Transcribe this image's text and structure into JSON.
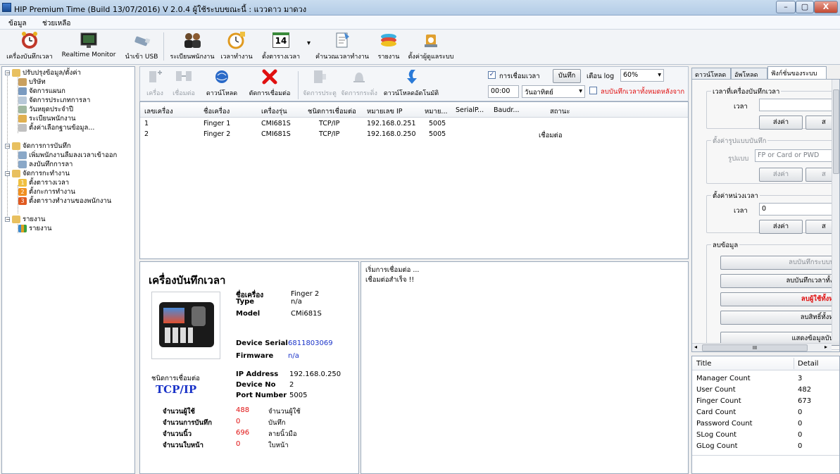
{
  "window": {
    "title": "HIP Premium Time (Build 13/07/2016) V 2.0.4   ผู้ใช้ระบบขณะนี้  : แววดาว  มาดวง",
    "minimize": "–",
    "maximize": "▢",
    "close": "X"
  },
  "menu": [
    "ข้อมูล",
    "ช่วยเหลือ"
  ],
  "toolbar": [
    {
      "label": "เครื่องบันทึกเวลา",
      "icon": "clock-icon"
    },
    {
      "label": "Realtime Monitor",
      "icon": "monitor-icon"
    },
    {
      "label": "นำเข้า USB",
      "icon": "usb-icon"
    },
    {
      "label": "ระเบียนพนักงาน",
      "icon": "employees-icon"
    },
    {
      "label": "เวลาทำงาน",
      "icon": "work-time-icon"
    },
    {
      "label": "ตั้งตารางเวลา",
      "icon": "calendar-icon"
    },
    {
      "label": "คำนวณเวลาทำงาน",
      "icon": "calculate-icon"
    },
    {
      "label": "รายงาน",
      "icon": "report-icon"
    },
    {
      "label": "ตั้งค่าผู้ดูแลระบบ",
      "icon": "admin-settings-icon"
    }
  ],
  "calendar_day": "14",
  "tree": [
    {
      "label": "ปรับปรุงข้อมูล/ตั้งค่า",
      "level": 0
    },
    {
      "label": "บริษัท",
      "level": 1
    },
    {
      "label": "จัดการแผนก",
      "level": 1
    },
    {
      "label": "จัดการประเภทการลา",
      "level": 1
    },
    {
      "label": "วันหยุดประจำปี",
      "level": 1
    },
    {
      "label": "ระเบียนพนักงาน",
      "level": 1
    },
    {
      "label": "ตั้งค่าเลือกฐานข้อมูล...",
      "level": 1
    },
    {
      "label": "จัดการการบันทึก",
      "level": 0
    },
    {
      "label": "เพิ่มพนักงานลืมลงเวลาเข้าออก",
      "level": 1
    },
    {
      "label": "ลงบันทึกการลา",
      "level": 1
    },
    {
      "label": "จัดการกะทำงาน",
      "level": 0
    },
    {
      "label": "ตั้งตารางเวลา",
      "level": 1,
      "num": "1"
    },
    {
      "label": "ตั้งกะการทำงาน",
      "level": 1,
      "num": "2"
    },
    {
      "label": "ตั้งตารางทำงานของพนักงาน",
      "level": 1,
      "num": "3"
    },
    {
      "label": "รายงาน",
      "level": 0
    },
    {
      "label": "รายงาน",
      "level": 1
    }
  ],
  "device_toolbar": {
    "buttons": [
      "เครื่อง",
      "เชื่อมต่อ",
      "ดาวน์โหลด",
      "ตัดการเชื่อมต่อ",
      "จัดการประตู",
      "จัดการกระดิ่ง",
      "ดาวน์โหลดอัตโนมัติ"
    ],
    "sync_time_label": "การเชื่อมเวลา",
    "save_button": "บันทึก",
    "log_warn_label": "เตือน log",
    "log_percent": "60%",
    "time_value": "00:00",
    "day_value": "วันอาทิตย์",
    "delete_after_label": "ลบบันทึกเวลาทั้งหมดหลังจาก"
  },
  "device_table": {
    "columns": [
      "เลขเครื่อง",
      "ชื่อเครื่อง",
      "เครื่องรุ่น",
      "ชนิดการเชื่อมต่อ",
      "หมายเลข IP",
      "หมาย...",
      "SerialP...",
      "Baudr...",
      "สถานะ"
    ],
    "rows": [
      [
        "1",
        "Finger 1",
        "CMI681S",
        "TCP/IP",
        "192.168.0.251",
        "5005",
        "",
        "",
        ""
      ],
      [
        "2",
        "Finger 2",
        "CMI681S",
        "TCP/IP",
        "192.168.0.250",
        "5005",
        "",
        "",
        "เชื่อมต่อ"
      ]
    ]
  },
  "device_info": {
    "heading": "เครื่องบันทึกเวลา",
    "name_label": "ชื่อเครื่อง",
    "name_value": "Finger 2",
    "type_label": "Type",
    "type_value": "n/a",
    "model_label": "Model",
    "model_value": "CMi681S",
    "serial_label": "Device Serial",
    "serial_value": "6811803069",
    "firmware_label": "Firmware",
    "firmware_value": "n/a",
    "conn_type_label": "ชนิดการเชื่อมต่อ",
    "conn_type_value": "TCP/IP",
    "ip_label": "IP Address",
    "ip_value": "192.168.0.250",
    "devno_label": "Device No",
    "devno_value": "2",
    "port_label": "Port Number",
    "port_value": "5005",
    "counts": [
      {
        "label": "จำนวนผู้ใช้",
        "value": "488",
        "unit": "จำนวนผู้ใช้"
      },
      {
        "label": "จำนวนการบันทึก",
        "value": "0",
        "unit": "บันทึก"
      },
      {
        "label": "จำนวนนิ้ว",
        "value": "696",
        "unit": "ลายนิ้วมือ"
      },
      {
        "label": "จำนวนใบหน้า",
        "value": "0",
        "unit": "ใบหน้า"
      }
    ]
  },
  "log_lines": [
    "เริ่มการเชื่อมต่อ ...",
    "เชื่อมต่อสำเร็จ !!"
  ],
  "right_tabs": [
    "ดาวน์โหลด",
    "อัพโหลด",
    "ฟังก์ชั่นของระบบ"
  ],
  "right_panel": {
    "set_time_group": "เวลาที่เครื่องบันทึกเวลา",
    "time_label": "เวลา",
    "send_button": "ส่งค่า",
    "cut_button": "ส",
    "format_group": "ตั้งค่ารูปแบบบันทึก",
    "format_label": "รูปแบบ",
    "format_value": "FP or Card or PWD",
    "interval_group": "ตั้งค่าหน่วงเวลา",
    "interval_value": "0",
    "delete_group": "ลบข้อมูล",
    "delete_buttons": [
      "ลบบันทึกระบบทั้งห",
      "ลบบันทึกเวลาทั้งหม",
      "ลบผู้ใช้ทั้งหมด",
      "ลบสิทธิ์ทั้งหมด",
      "แสดงข้อมูลบันทึก"
    ],
    "scroll_grip": "III"
  },
  "stats": {
    "header_title": "Title",
    "header_detail": "Detail",
    "rows": [
      {
        "title": "Manager Count",
        "detail": "3"
      },
      {
        "title": "User Count",
        "detail": "482"
      },
      {
        "title": "Finger Count",
        "detail": "673"
      },
      {
        "title": "Card Count",
        "detail": "0"
      },
      {
        "title": "Password Count",
        "detail": "0"
      },
      {
        "title": "SLog Count",
        "detail": "0"
      },
      {
        "title": "GLog Count",
        "detail": "0"
      }
    ]
  },
  "colors": {
    "accent_red": "#e01010",
    "link_blue": "#1a33c8",
    "tree_orange": "#f0a020"
  }
}
